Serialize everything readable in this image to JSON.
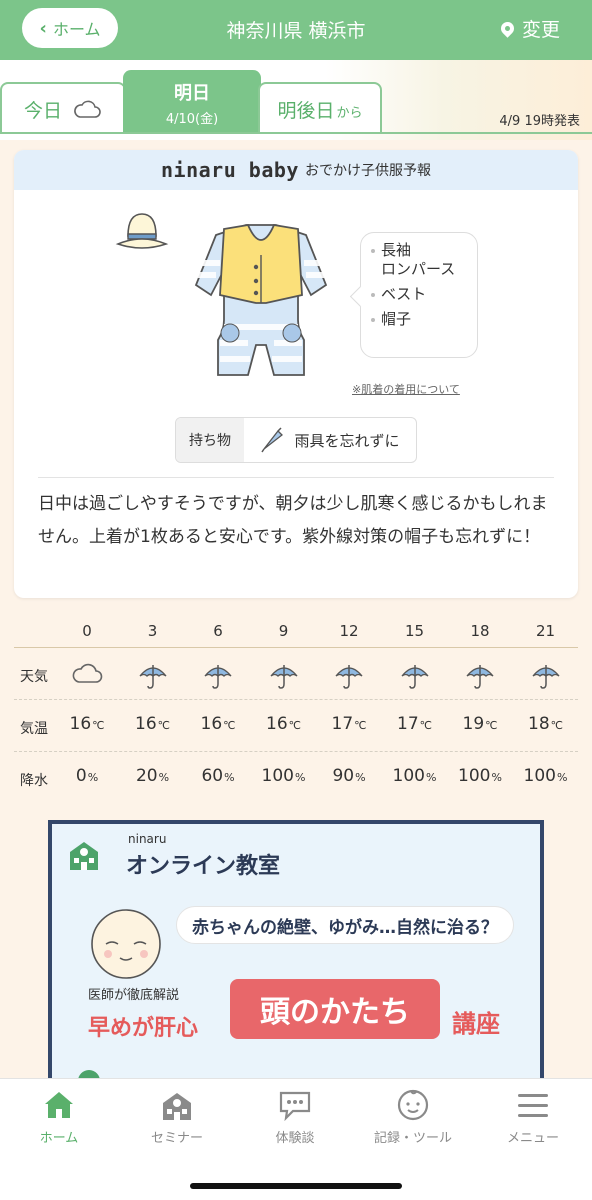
{
  "header": {
    "back_label": "ホーム",
    "title": "神奈川県 横浜市",
    "change_label": "変更"
  },
  "tabs": {
    "today": {
      "label": "今日",
      "icon": "cloud-icon"
    },
    "tomorrow": {
      "label": "明日",
      "date": "4/10(金)"
    },
    "day_after": {
      "label": "明後日",
      "suffix": "から"
    }
  },
  "issued": "4/9 19時発表",
  "card": {
    "brand": "ninaru baby",
    "subtitle": "おでかけ子供服予報",
    "clothing": [
      "長袖ロンパース",
      "ベスト",
      "帽子"
    ],
    "clothing_display": [
      "長袖",
      "ロンパース",
      "ベスト",
      "帽子"
    ],
    "note_link": "※肌着の着用について",
    "carry_label": "持ち物",
    "carry_value": "雨具を忘れずに",
    "comment": "日中は過ごしやすそうですが、朝夕は少し肌寒く感じるかもしれません。上着が1枚あると安心です。紫外線対策の帽子も忘れずに！"
  },
  "forecast": {
    "labels": {
      "weather": "天気",
      "temp": "気温",
      "rain": "降水"
    },
    "temp_unit": "℃",
    "rain_unit": "%",
    "hours": [
      "0",
      "3",
      "6",
      "9",
      "12",
      "15",
      "18",
      "21"
    ],
    "weather": [
      "cloud",
      "umbrella",
      "umbrella",
      "umbrella",
      "umbrella",
      "umbrella",
      "umbrella",
      "umbrella"
    ],
    "temps": [
      "16",
      "16",
      "16",
      "16",
      "17",
      "17",
      "19",
      "18"
    ],
    "rain": [
      "0",
      "20",
      "60",
      "100",
      "90",
      "100",
      "100",
      "100"
    ]
  },
  "banner": {
    "brand": "ninaru",
    "title": "オンライン教室",
    "question": "赤ちゃんの絶壁、ゆがみ…自然に治る？",
    "doctor": "医師が徹底解説",
    "early": "早めが肝心",
    "headline": "頭のかたち",
    "course": "講座"
  },
  "nav": [
    {
      "label": "ホーム",
      "icon": "home-icon",
      "active": true
    },
    {
      "label": "セミナー",
      "icon": "school-icon",
      "active": false
    },
    {
      "label": "体験談",
      "icon": "chat-icon",
      "active": false
    },
    {
      "label": "記録・ツール",
      "icon": "baby-face-icon",
      "active": false
    },
    {
      "label": "メニュー",
      "icon": "menu-icon",
      "active": false
    }
  ],
  "colors": {
    "accent": "#7cc58a",
    "navy": "#2c3a56",
    "red": "#e55b5b",
    "sky": "#e3effa"
  }
}
